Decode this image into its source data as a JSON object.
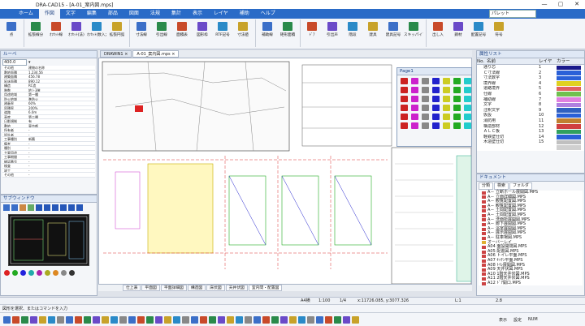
{
  "title": "DRA-CAD15 - [A-01_案内図.mps]",
  "window_buttons": [
    "—",
    "▢",
    "✕"
  ],
  "ribbon_tabs": [
    "ホーム",
    "作図",
    "文字",
    "編集",
    "部品",
    "図面",
    "法規",
    "集計",
    "表示",
    "レイヤ",
    "補助",
    "ヘルプ"
  ],
  "active_tab": "作図",
  "palette_label": "パレット",
  "ribbon_buttons": [
    "点",
    "拡張線分",
    "ｵﾌｾｯﾄ線",
    "ｵﾌｾｯﾄ(法)",
    "ｵﾌｾｯﾄ(数入力)",
    "拡張円弧",
    "寸法線",
    "引出線",
    "面積表",
    "図形枠",
    "RTF記号",
    "寸法値",
    "補助線",
    "矩形面積",
    "ﾄﾞｱ",
    "引出声",
    "階段",
    "建具",
    "建具記号",
    "スキッパイプ",
    "出し入",
    "鋼材",
    "配置記号",
    "符号"
  ],
  "loupe": {
    "title": "ルーペ",
    "zoom": "400.0",
    "prop_rows": [
      [
        "その他",
        "建物の名称"
      ],
      [
        "敷地面積",
        "1,234.56"
      ],
      [
        "建築面積",
        "456.78"
      ],
      [
        "延床面積",
        "890.12"
      ],
      [
        "構造",
        "RC造"
      ],
      [
        "階数",
        "地上3階"
      ],
      [
        "用途地域",
        "第一種"
      ],
      [
        "防火地域",
        "準防火"
      ],
      [
        "建蔽率",
        "60%"
      ],
      [
        "容積率",
        "200%"
      ],
      [
        "道路",
        "6.0m"
      ],
      [
        "高度",
        "第二種"
      ],
      [
        "日影規制",
        "有"
      ],
      [
        "敷地",
        "東京都"
      ],
      [
        "所有者",
        "-"
      ],
      [
        "設計者",
        "-"
      ],
      [
        "工事種別",
        "新築"
      ],
      [
        "備考",
        "-"
      ],
      [
        "種別",
        "-"
      ],
      [
        "主要用途",
        "-"
      ],
      [
        "工事期間",
        "-"
      ],
      [
        "確認番号",
        "-"
      ],
      [
        "検査",
        "-"
      ],
      [
        "竣工",
        "-"
      ],
      [
        "その他",
        "-"
      ]
    ]
  },
  "thumb": {
    "title": "サブウィンドウ"
  },
  "doc_tabs": [
    "DRAWIN1 ×",
    "A-01_案内図.mps ×"
  ],
  "layout_tabs": [
    "仕上表",
    "平面図",
    "平面詳細図",
    "構造図",
    "床伏図",
    "天井伏図",
    "室内間・配置図"
  ],
  "float_palette_title": "Page1",
  "layer_panel": {
    "title": "属性リスト",
    "headers": [
      "No.",
      "名前",
      "レイヤ",
      "カラー"
    ],
    "rows": [
      {
        "no": "1",
        "name": "通り芯",
        "layer": "1",
        "color": "#1a1a8c"
      },
      {
        "no": "2",
        "name": "Ｃ寸法線",
        "layer": "2",
        "color": "#2a60d8"
      },
      {
        "no": "3",
        "name": "寸法数字",
        "layer": "3",
        "color": "#2a60d8"
      },
      {
        "no": "4",
        "name": "境界線",
        "layer": "4",
        "color": "#e0d020"
      },
      {
        "no": "5",
        "name": "道路境界",
        "layer": "5",
        "color": "#e06060"
      },
      {
        "no": "6",
        "name": "仕線",
        "layer": "6",
        "color": "#70c050"
      },
      {
        "no": "7",
        "name": "補助線",
        "layer": "7",
        "color": "#e080e0"
      },
      {
        "no": "8",
        "name": "文字",
        "layer": "8",
        "color": "#b080e0"
      },
      {
        "no": "9",
        "name": "注釈文字",
        "layer": "9",
        "color": "#3060c0"
      },
      {
        "no": "10",
        "name": "仮設",
        "layer": "10",
        "color": "#2a60d8"
      },
      {
        "no": "11",
        "name": "消防用",
        "layer": "11",
        "color": "#c08030"
      },
      {
        "no": "12",
        "name": "構造部材",
        "layer": "12",
        "color": "#d04040"
      },
      {
        "no": "13",
        "name": "ＡＬＣ板",
        "layer": "13",
        "color": "#30a060"
      },
      {
        "no": "14",
        "name": "軽鉄壁仕切",
        "layer": "14",
        "color": "#2a60d8"
      },
      {
        "no": "15",
        "name": "木造壁仕切",
        "layer": "15",
        "color": "#c0c0c0"
      },
      {
        "no": "16",
        "name": "",
        "layer": "",
        "color": "#d0d0d0"
      }
    ]
  },
  "doc_panel": {
    "title": "ドキュメント",
    "tabs": [
      "分類",
      "検索",
      "フォルダ"
    ],
    "rows": [
      "A－ 立断ホール展開図.MPS",
      "A－ 立面詳細図.MPS",
      "A－ 観覧配置図.MPS",
      "A－ 観覧配置図.MPS",
      "A－ 土間配置図.MPS",
      "A－ 土間配置図.MPS",
      "A－ 洗面所展開図.MPS",
      "A－ 廊下展開図.MPS",
      "A－ 浴室展開図.MPS",
      "A－ 展示展開図.MPS",
      "A－ 駐車場図.MPS",
      "オーバーレイ",
      "A04 面設開閉図.MPS",
      "A05 配置図.MPS",
      "A06 トイレ平面.MPS",
      "A07 ｷｯﾁﾝ平面.MPS",
      "A08 ﾄｲﾚ展開図.MPS",
      "A09 天井伏図.MPS",
      "A10 1階天井伏図.MPS",
      "A11 2階天井伏図.MPS",
      "A12 ﾄﾞｱ開口.MPS"
    ]
  },
  "statusbar": {
    "left": "",
    "mid1": "A4横",
    "mid2": "1:100",
    "mid3": "1/4",
    "coords": "x:11726.085, y:3077.326",
    "right": "L:1",
    "far_right": "2.8"
  },
  "cmdbar": "図形を選択、またはコマンドを入力",
  "botbar_right": [
    "表示",
    "設定",
    "NUM"
  ]
}
